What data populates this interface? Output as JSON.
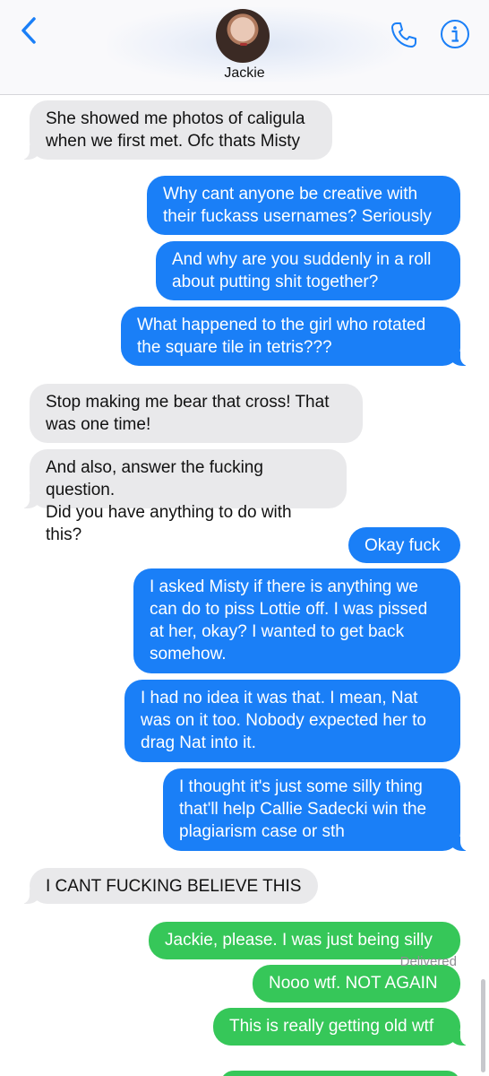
{
  "header": {
    "contact_name": "Jackie",
    "back_icon": "chevron-left-icon",
    "call_icon": "phone-icon",
    "info_icon": "info-icon",
    "accent_color": "#1a7ff7"
  },
  "messages": [
    {
      "type": "received",
      "text": "She showed me photos of caligula\nwhen we first met. Ofc thats Misty"
    },
    {
      "type": "sent",
      "text": "Why cant anyone be creative with\ntheir fuckass usernames? Seriously"
    },
    {
      "type": "sent",
      "text": "And why are you suddenly in a roll\nabout putting shit together?"
    },
    {
      "type": "sent",
      "text": "What happened to the girl who rotated\nthe square tile in tetris???"
    },
    {
      "type": "received",
      "text": "Stop making me bear that cross! That\nwas one time!"
    },
    {
      "type": "received",
      "text": "And also, answer the fucking question.\nDid you have anything to do with this?"
    },
    {
      "type": "sent",
      "text": "Okay fuck"
    },
    {
      "type": "sent",
      "text": "I asked Misty if there is anything we\ncan do to piss Lottie off. I was pissed\nat her, okay? I wanted to get back\nsomehow."
    },
    {
      "type": "sent",
      "text": "I had no idea it was that. I mean, Nat\nwas on it too. Nobody expected her to\ndrag Nat into it."
    },
    {
      "type": "sent",
      "text": "I thought it's just some silly thing\nthat'll help Callie Sadecki win the\nplagiarism case or sth"
    },
    {
      "type": "received",
      "text": "I CANT FUCKING BELIEVE THIS"
    },
    {
      "type": "sent_sms",
      "text": "Jackie, please. I was just being silly"
    },
    {
      "type": "sent_sms",
      "text": "Nooo wtf. NOT AGAIN"
    },
    {
      "type": "sent_sms",
      "text": "This is really getting old wtf"
    }
  ],
  "status": {
    "delivered": "Delivered"
  },
  "colors": {
    "received_bubble": "#e9e9eb",
    "imessage_bubble": "#1a7ff7",
    "sms_bubble": "#36c759"
  }
}
